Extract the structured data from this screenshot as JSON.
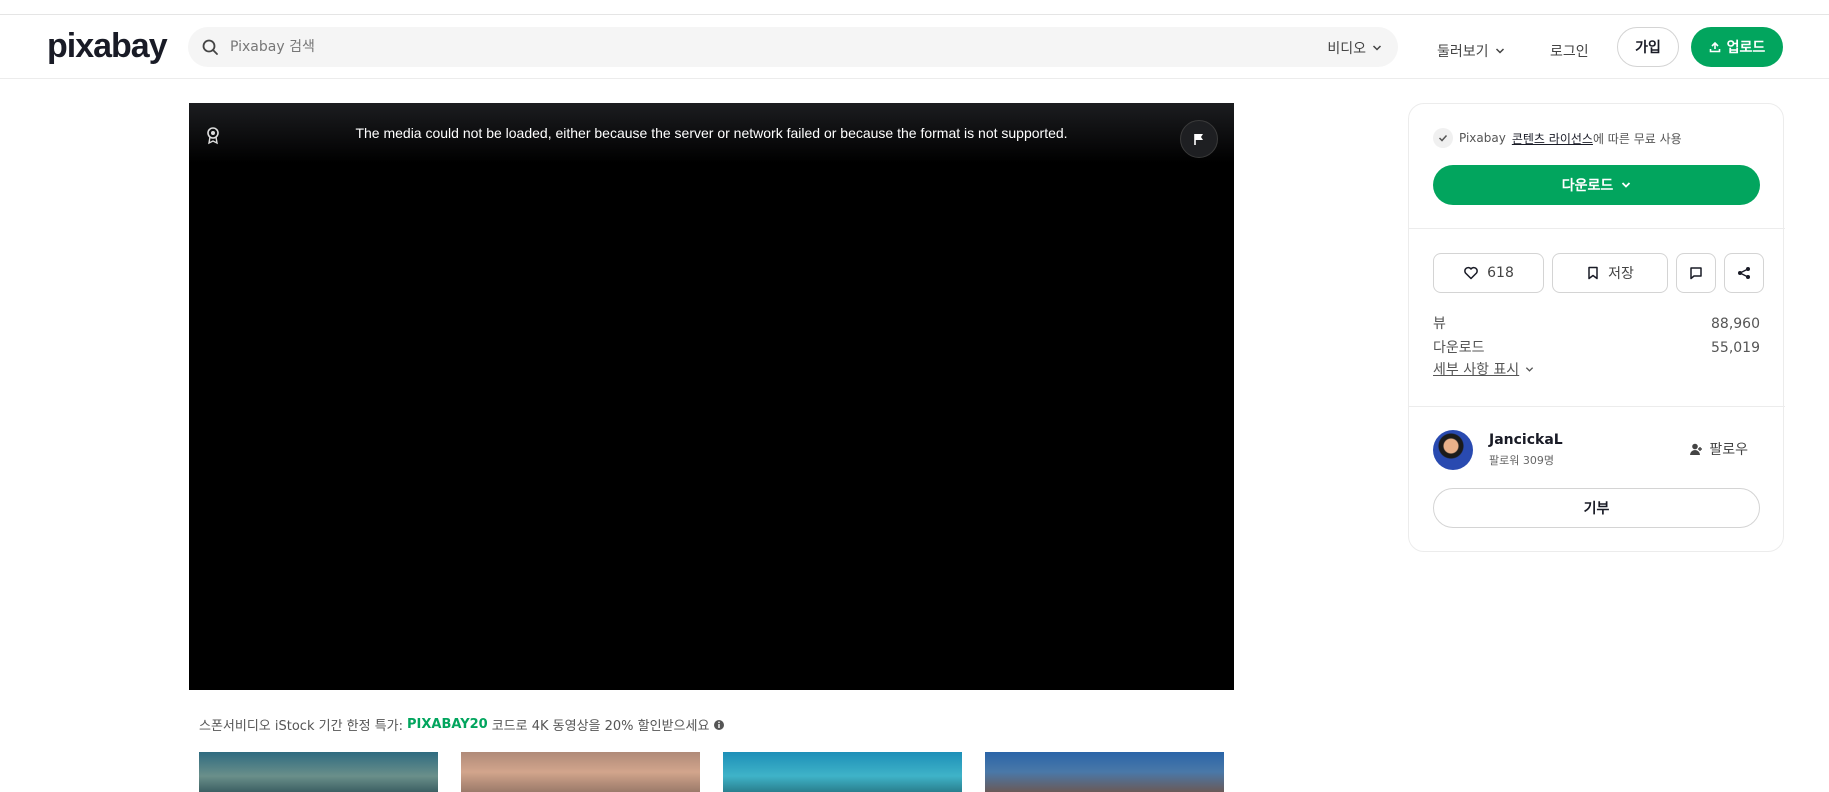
{
  "header": {
    "logo": "pixabay",
    "search_placeholder": "Pixabay 검색",
    "search_type": "비디오",
    "explore_label": "둘러보기",
    "login_label": "로그인",
    "join_label": "가입",
    "upload_label": "업로드"
  },
  "player": {
    "error_message": "The media could not be loaded, either because the server or network failed or because the format is not supported."
  },
  "promo": {
    "prefix": "스폰서비디오 iStock 기간 한정 특가:",
    "code": "PIXABAY20",
    "suffix": "코드로 4K 동영상을 20% 할인받으세요"
  },
  "panel": {
    "license_prefix": "Pixabay",
    "license_link": "콘텐츠 라이선스",
    "license_suffix": "에 따른 무료 사용",
    "download_label": "다운로드",
    "likes": "618",
    "save_label": "저장",
    "stats": [
      {
        "label": "뷰",
        "value": "88,960"
      },
      {
        "label": "다운로드",
        "value": "55,019"
      }
    ],
    "details_label": "세부 사항 표시",
    "author": {
      "name": "JancickaL",
      "followers": "팔로워 309명",
      "follow_label": "팔로우"
    },
    "donate_label": "기부"
  },
  "colors": {
    "accent": "#02a55e",
    "text": "#191b26"
  }
}
